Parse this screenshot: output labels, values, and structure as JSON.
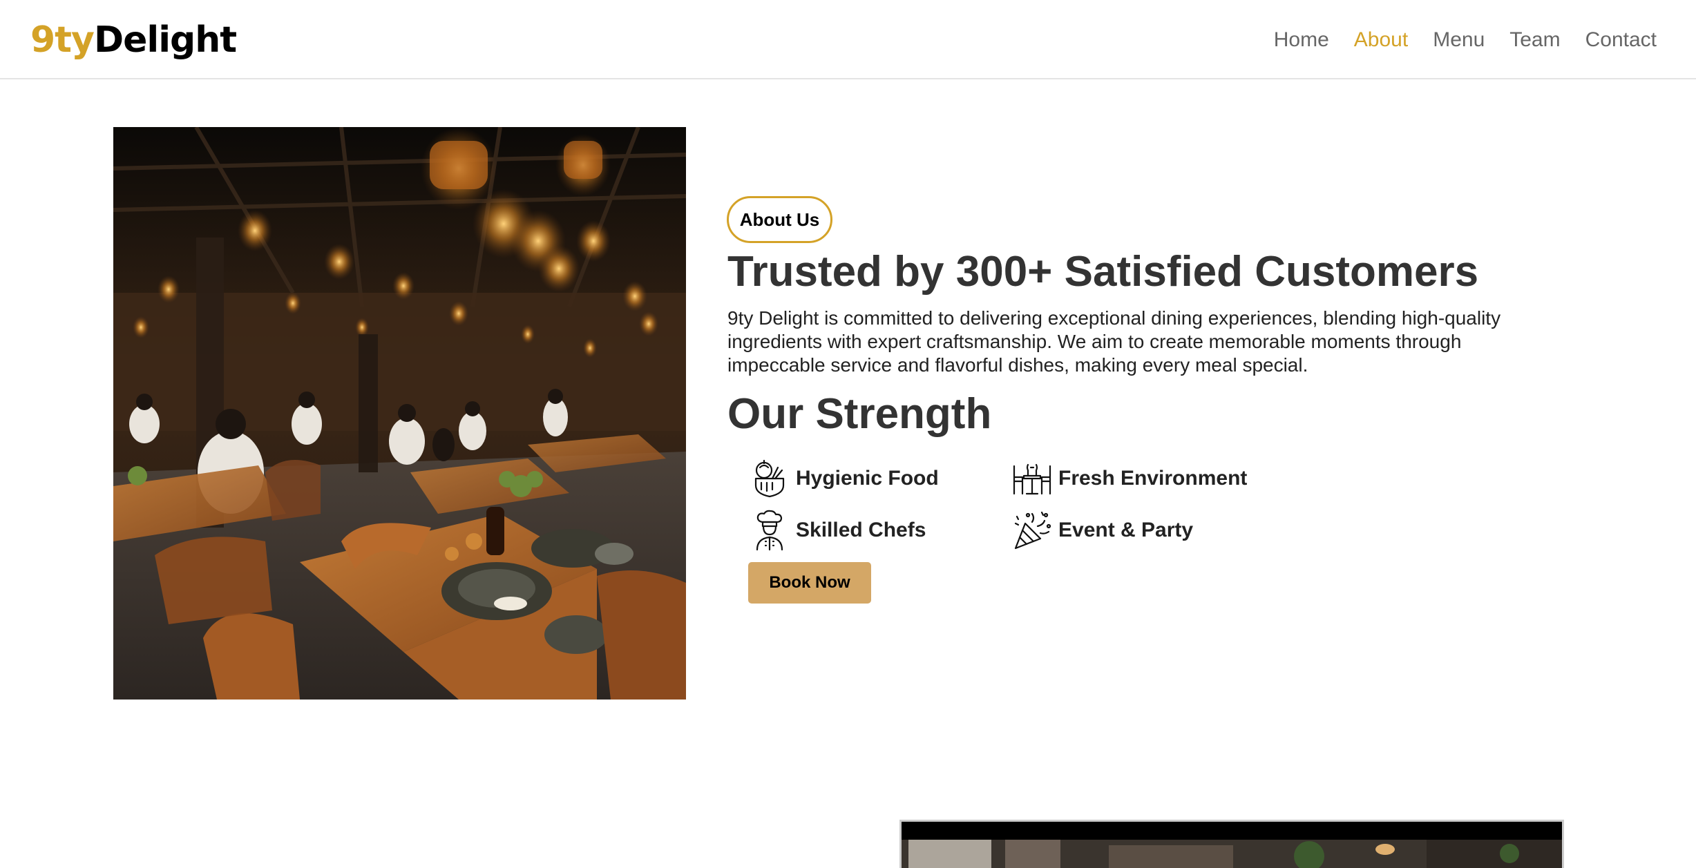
{
  "brand": {
    "accent": "9ty",
    "rest": "Delight",
    "accent_color": "#d4a227"
  },
  "nav": {
    "items": [
      {
        "label": "Home"
      },
      {
        "label": "About"
      },
      {
        "label": "Menu"
      },
      {
        "label": "Team"
      },
      {
        "label": "Contact"
      }
    ],
    "active": "About"
  },
  "hero": {
    "image": "restaurant-interior-photo"
  },
  "about": {
    "pill": "About Us",
    "title": "Trusted by 300+ Satisfied Customers",
    "description": "9ty Delight is committed to delivering exceptional dining experiences, blending high-quality ingredients with expert craftsmanship. We aim to create memorable moments through impeccable service and flavorful dishes, making every meal special.",
    "strength_title": "Our Strength",
    "features": [
      {
        "label": "Hygienic Food",
        "icon": "vegetables-icon"
      },
      {
        "label": "Skilled Chefs",
        "icon": "chef-icon"
      },
      {
        "label": "Fresh Environment",
        "icon": "dining-table-icon"
      },
      {
        "label": "Event & Party",
        "icon": "party-popper-icon"
      }
    ],
    "cta": "Book Now",
    "cta_color": "#d4a766"
  },
  "next_section": {
    "image": "restaurant-photo-partial"
  }
}
